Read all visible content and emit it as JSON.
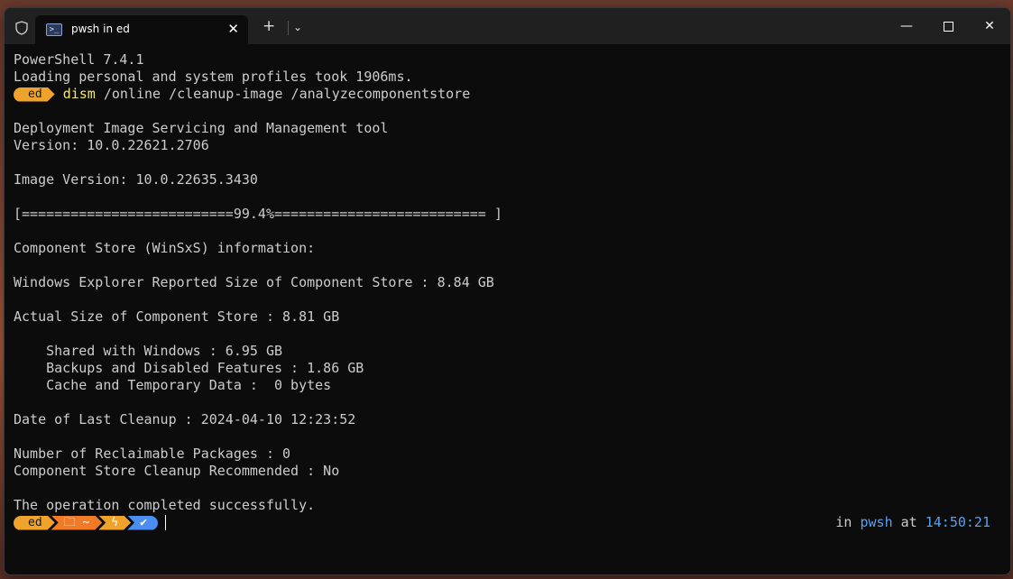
{
  "window": {
    "tab_title": "pwsh in ed",
    "tab_icon_glyph": ">_",
    "new_tab_glyph": "+",
    "dropdown_glyph": "⌄",
    "close_tab_glyph": "✕",
    "minimize_glyph": "—",
    "close_glyph": "✕"
  },
  "terminal": {
    "lines": [
      "PowerShell 7.4.1",
      "Loading personal and system profiles took 1906ms."
    ],
    "prompt1": {
      "user": "ed",
      "command": "dism",
      "args": " /online /cleanup-image /analyzecomponentstore"
    },
    "output": [
      "",
      "Deployment Image Servicing and Management tool",
      "Version: 10.0.22621.2706",
      "",
      "Image Version: 10.0.22635.3430",
      "",
      "[==========================99.4%========================== ]",
      "",
      "Component Store (WinSxS) information:",
      "",
      "Windows Explorer Reported Size of Component Store : 8.84 GB",
      "",
      "Actual Size of Component Store : 8.81 GB",
      "",
      "    Shared with Windows : 6.95 GB",
      "    Backups and Disabled Features : 1.86 GB",
      "    Cache and Temporary Data :  0 bytes",
      "",
      "Date of Last Cleanup : 2024-04-10 12:23:52",
      "",
      "Number of Reclaimable Packages : 0",
      "Component Store Cleanup Recommended : No",
      "",
      "The operation completed successfully."
    ],
    "prompt2": {
      "user": "ed",
      "path": "🗀 ~",
      "power_glyph": "ϟ",
      "status_glyph": "✔",
      "right_in": "in ",
      "right_shell": "pwsh",
      "right_at": " at ",
      "right_time": "14:50:21"
    }
  },
  "colors": {
    "user_segment": "#f0a32a",
    "path_segment": "#f07a25",
    "status_segment": "#4a8ff0",
    "command": "#f2e86a",
    "accent": "#5aa0f0"
  }
}
